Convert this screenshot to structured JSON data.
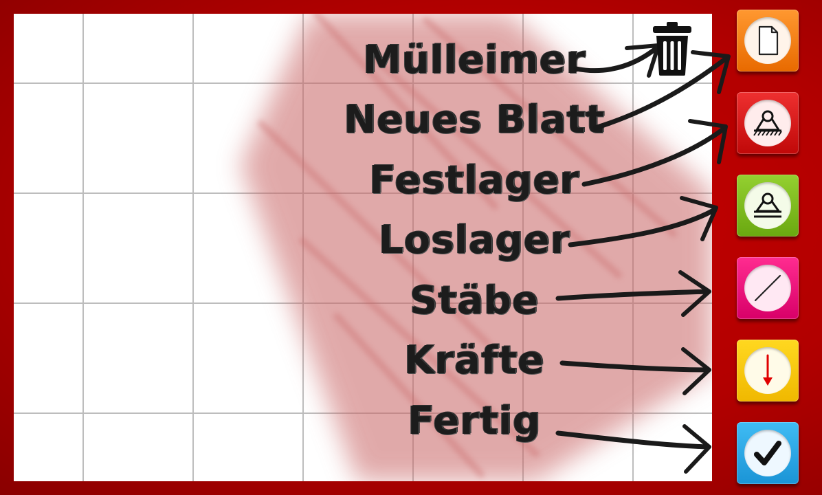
{
  "hints": [
    {
      "id": "trash",
      "label": "Mülleimer"
    },
    {
      "id": "new-sheet",
      "label": "Neues Blatt"
    },
    {
      "id": "fixed-support",
      "label": "Festlager"
    },
    {
      "id": "roller-support",
      "label": "Loslager"
    },
    {
      "id": "bars",
      "label": "Stäbe"
    },
    {
      "id": "forces",
      "label": "Kräfte"
    },
    {
      "id": "done",
      "label": "Fertig"
    }
  ],
  "toolbar": [
    {
      "id": "new-sheet",
      "icon": "document-icon",
      "color": "#f07a10"
    },
    {
      "id": "fixed-support",
      "icon": "fixed-support-icon",
      "color": "#d01818"
    },
    {
      "id": "roller-support",
      "icon": "roller-support-icon",
      "color": "#7cbc1e"
    },
    {
      "id": "bars",
      "icon": "bar-line-icon",
      "color": "#e8107a"
    },
    {
      "id": "forces",
      "icon": "force-arrow-icon",
      "color": "#f6c800"
    },
    {
      "id": "done",
      "icon": "checkmark-icon",
      "color": "#28a8e8"
    }
  ],
  "trash": {
    "icon": "trash-icon"
  },
  "colors": {
    "frame": "#b80000",
    "grid": "#bdbdbd",
    "smear": "#c86464"
  }
}
